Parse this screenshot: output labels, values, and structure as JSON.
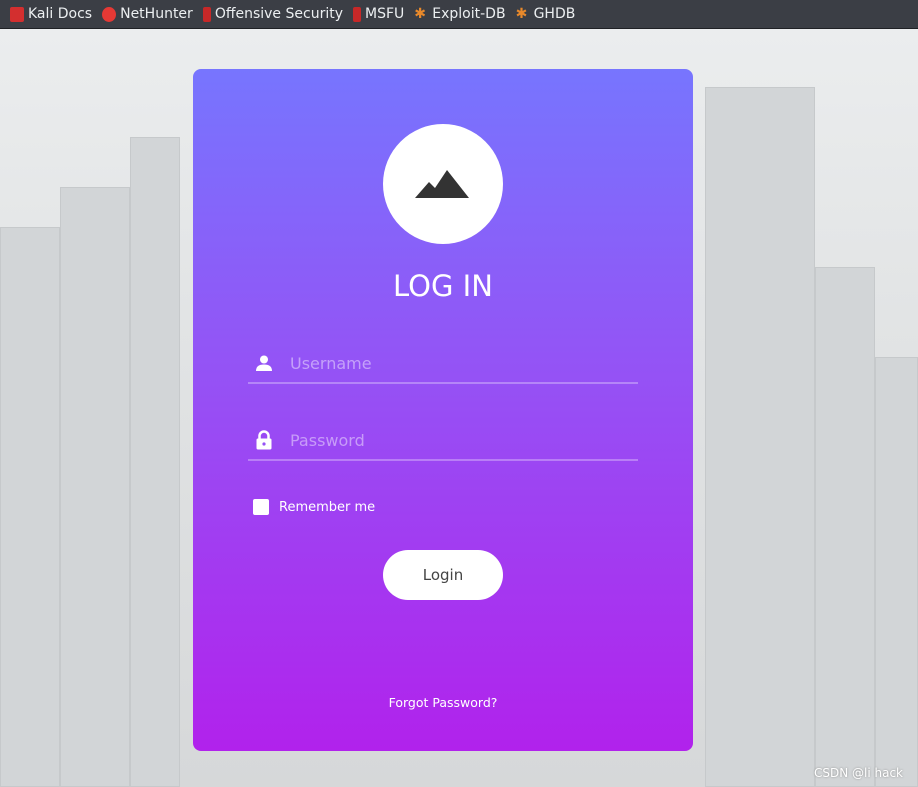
{
  "bookmarks": [
    {
      "label": "Kali Docs",
      "icon": "kali-docs-icon",
      "color": "#d32f2f"
    },
    {
      "label": "NetHunter",
      "icon": "nethunter-icon",
      "color": "#e53935"
    },
    {
      "label": "Offensive Security",
      "icon": "offsec-icon",
      "color": "#c62828"
    },
    {
      "label": "MSFU",
      "icon": "offsec-icon",
      "color": "#c62828"
    },
    {
      "label": "Exploit-DB",
      "icon": "exploit-db-spider-icon",
      "color": "#e8892b"
    },
    {
      "label": "GHDB",
      "icon": "exploit-db-spider-icon",
      "color": "#e8892b"
    }
  ],
  "login": {
    "title": "LOG IN",
    "username_placeholder": "Username",
    "username_value": "",
    "password_placeholder": "Password",
    "password_value": "",
    "remember_label": "Remember me",
    "login_label": "Login",
    "forgot_label": "Forgot Password?"
  },
  "watermark": "CSDN @li hack",
  "colors": {
    "gradient_top": "#7775fe",
    "gradient_bottom": "#b122ec"
  }
}
